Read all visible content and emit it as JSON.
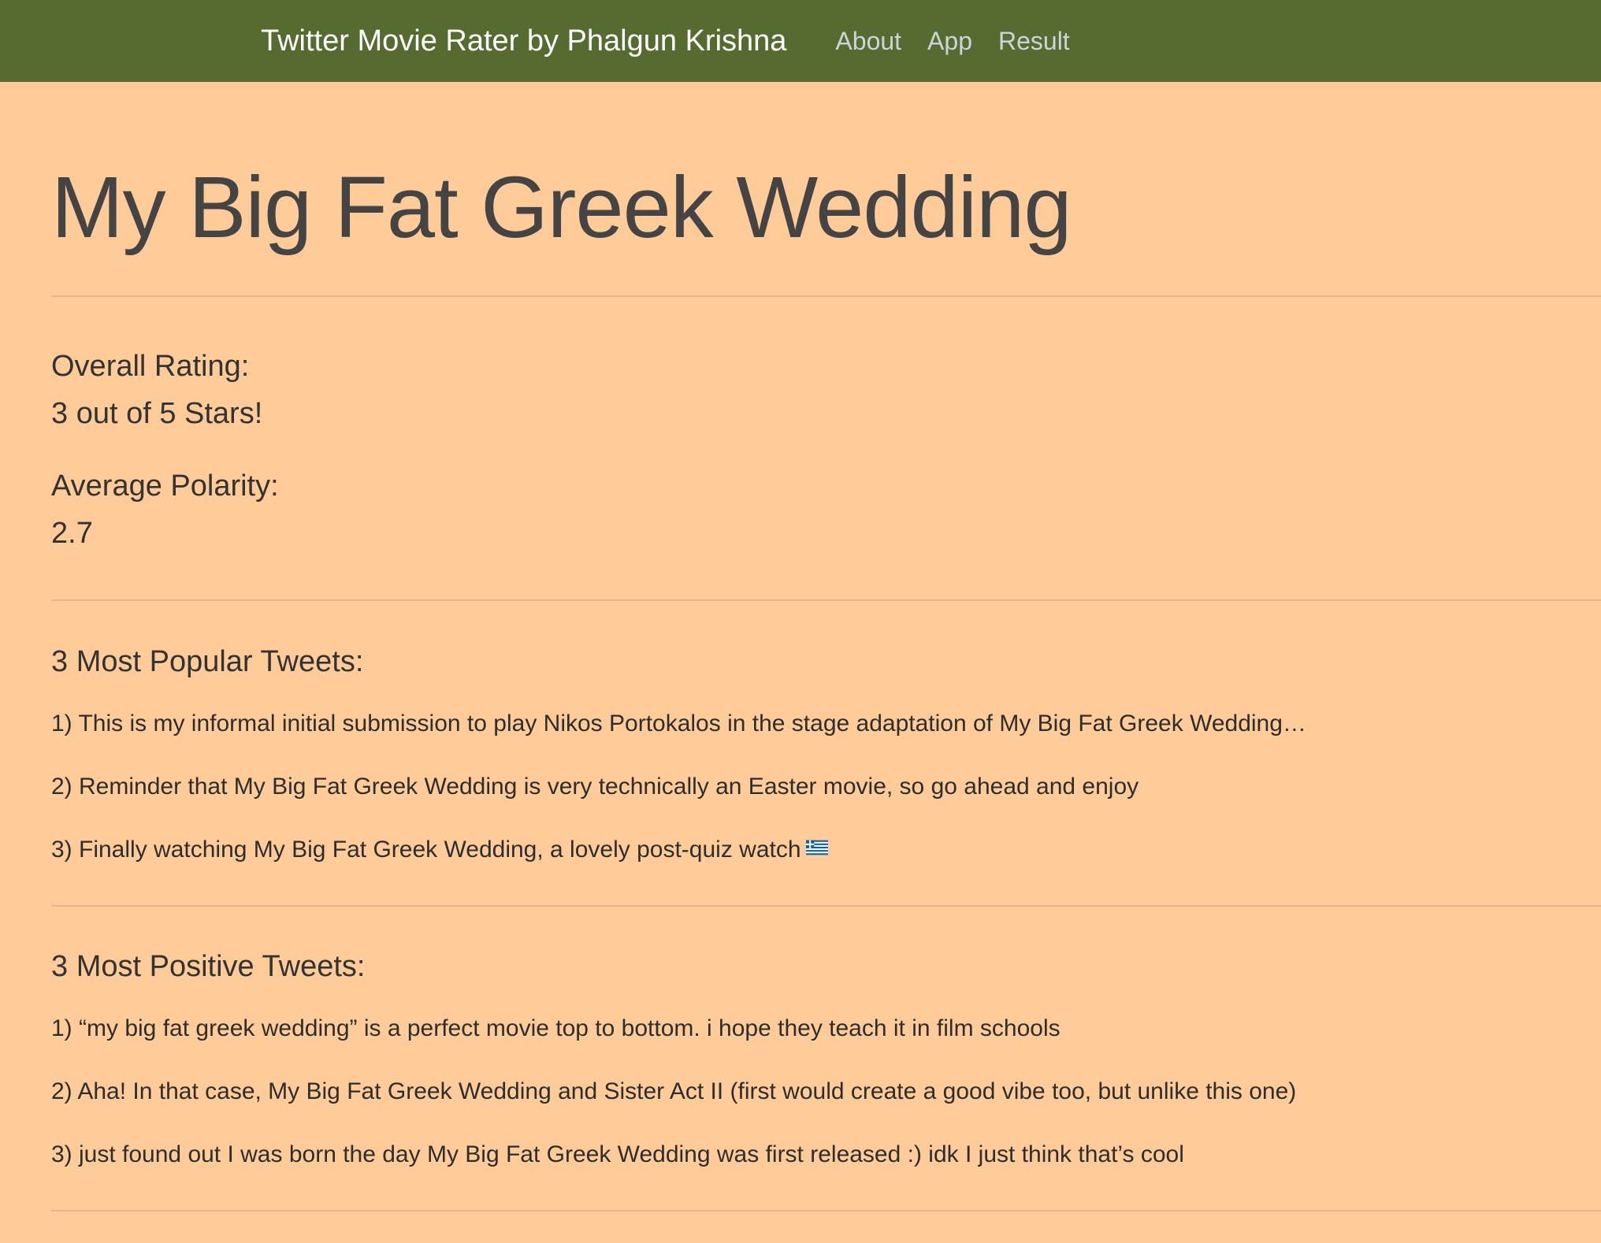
{
  "navbar": {
    "brand": "Twitter Movie Rater by Phalgun Krishna",
    "links": [
      "About",
      "App",
      "Result"
    ]
  },
  "page": {
    "title": "My Big Fat Greek Wedding"
  },
  "stats": {
    "overall_label": "Overall Rating:",
    "overall_value": "3 out of 5 Stars!",
    "polarity_label": "Average Polarity:",
    "polarity_value": "2.7"
  },
  "popular": {
    "heading": "3 Most Popular Tweets:",
    "tweets": [
      "1) This is my informal initial submission to play Nikos Portokalos in the stage adaptation of My Big Fat Greek Wedding…",
      "2) Reminder that My Big Fat Greek Wedding is very technically an Easter movie, so go ahead and enjoy",
      "3) Finally watching My Big Fat Greek Wedding, a lovely post-quiz watch"
    ],
    "tweet3_icon": "greek-flag-icon"
  },
  "positive": {
    "heading": "3 Most Positive Tweets:",
    "tweets": [
      "1) “my big fat greek wedding” is a perfect movie top to bottom. i hope they teach it in film schools",
      "2) Aha! In that case, My Big Fat Greek Wedding and Sister Act II (first would create a good vibe too, but unlike this one)",
      "3) just found out I was born the day My Big Fat Greek Wedding was first released :) idk I just think that’s cool"
    ]
  },
  "colors": {
    "navbar": "#556b2f",
    "background": "#ffcc99",
    "nav_link": "#c9d6dc"
  }
}
